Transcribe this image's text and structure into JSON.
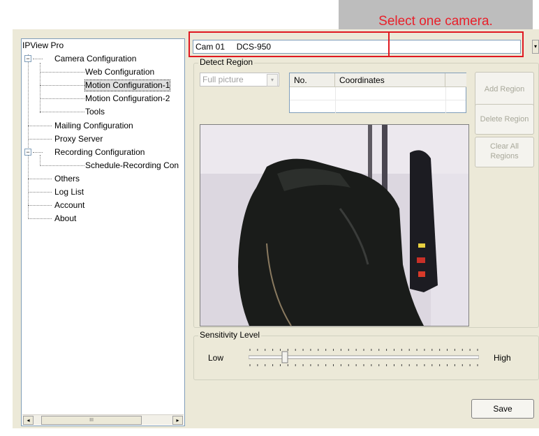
{
  "callout": {
    "text": "Select one camera."
  },
  "tree": {
    "items": [
      {
        "label": "IPView Pro"
      },
      {
        "label": "Camera Configuration",
        "expander": "−"
      },
      {
        "label": "Web Configuration"
      },
      {
        "label": "Motion Configuration-1"
      },
      {
        "label": "Motion Configuration-2"
      },
      {
        "label": "Tools"
      },
      {
        "label": "Mailing Configuration"
      },
      {
        "label": "Proxy Server"
      },
      {
        "label": "Recording Configuration",
        "expander": "−"
      },
      {
        "label": "Schedule-Recording Con"
      },
      {
        "label": "Others"
      },
      {
        "label": "Log List"
      },
      {
        "label": "Account"
      },
      {
        "label": "About"
      }
    ],
    "scroll_thumb": "III",
    "scroll_left": "◂",
    "scroll_right": "▸"
  },
  "camera_select": {
    "value": "Cam 01     DCS-950",
    "arrow": "▾"
  },
  "detect_region": {
    "label": "Detect Region",
    "region_select": "Full picture",
    "arrow": "▾",
    "table_headers": [
      "No.",
      "Coordinates"
    ],
    "add_region": "Add Region",
    "delete_region": "Delete Region",
    "clear_all_regions": "Clear All Regions"
  },
  "sensitivity": {
    "label": "Sensitivity Level",
    "low": "Low",
    "high": "High",
    "level_fraction": 0.15
  },
  "save_label": "Save",
  "colors": {
    "accent_red": "#e01820",
    "callout_bg": "#bdbdbd",
    "window_bg": "#ece9d8"
  }
}
